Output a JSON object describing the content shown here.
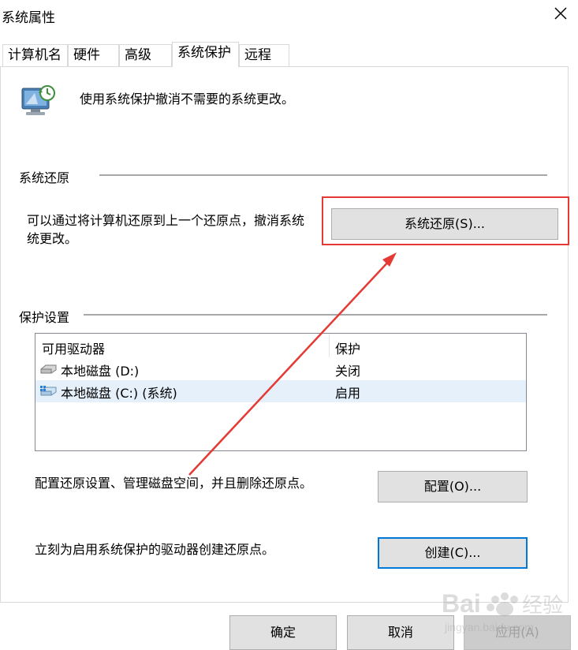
{
  "window": {
    "title": "系统属性"
  },
  "tabs": [
    {
      "label": "计算机名",
      "active": false
    },
    {
      "label": "硬件",
      "active": false
    },
    {
      "label": "高级",
      "active": false
    },
    {
      "label": "系统保护",
      "active": true
    },
    {
      "label": "远程",
      "active": false
    }
  ],
  "intro": {
    "text": "使用系统保护撤消不需要的系统更改。",
    "icon": "system-protection-icon"
  },
  "restore_group": {
    "title": "系统还原",
    "description_line1": "可以通过将计算机还原到上一个还原点，撤消系统",
    "description_line2": "统更改。",
    "button_label": "系统还原(S)..."
  },
  "protection_group": {
    "title": "保护设置",
    "columns": [
      "可用驱动器",
      "保护"
    ],
    "rows": [
      {
        "drive": "本地磁盘 (D:)",
        "protection": "关闭",
        "selected": false,
        "icon": "drive-icon"
      },
      {
        "drive": "本地磁盘 (C:) (系统)",
        "protection": "启用",
        "selected": true,
        "icon": "system-drive-icon"
      }
    ],
    "configure_text": "配置还原设置、管理磁盘空间，并且删除还原点。",
    "configure_button": "配置(O)...",
    "create_text": "立刻为启用系统保护的驱动器创建还原点。",
    "create_button": "创建(C)..."
  },
  "footer": {
    "ok": "确定",
    "cancel": "取消",
    "apply": "应用(A)"
  },
  "watermark": {
    "brand": "Bai",
    "brand2": "经验",
    "url": "jingyan.baidu.com"
  },
  "colors": {
    "annotation_red": "#e53935",
    "focus_blue": "#0078d7"
  }
}
